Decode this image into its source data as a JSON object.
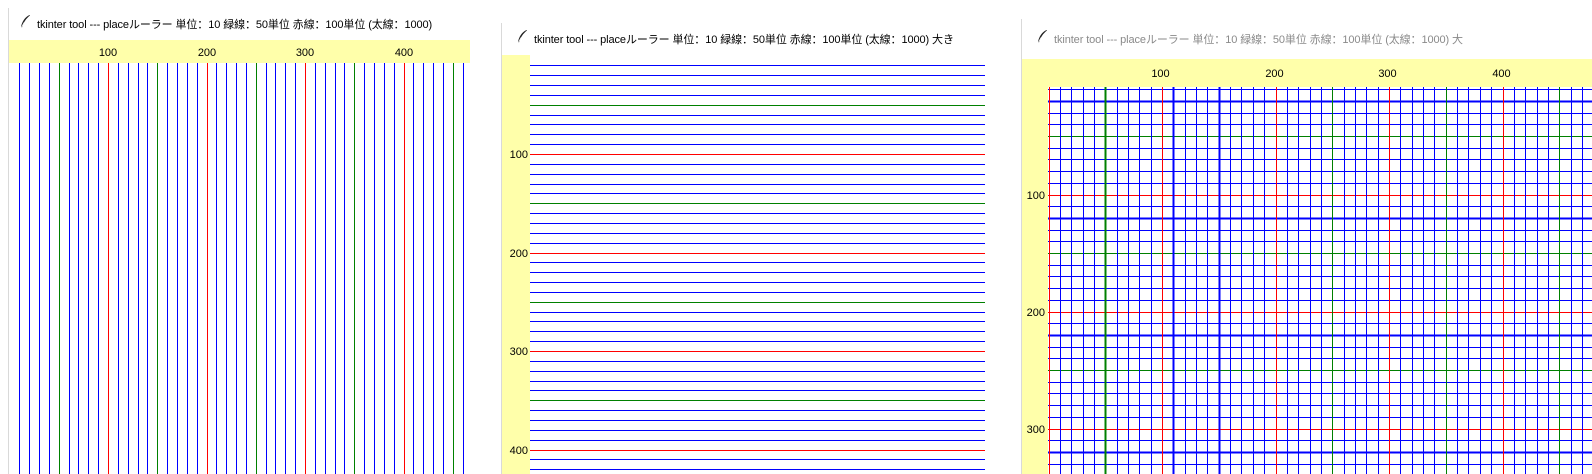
{
  "colors": {
    "ruler_background": "#ffffaa",
    "unit_line": "#0000ff",
    "green_line": "#008000",
    "red_line": "#ff0000",
    "thick_line": "#0000ff"
  },
  "windows": [
    {
      "icon": "feather-icon",
      "title": "tkinter tool  --- placeルーラー  単位：10  緑線：50単位  赤線：100単位 (太線：1000)",
      "mode": "vertical-lines",
      "ruler_labels": [
        "100",
        "200",
        "300",
        "400"
      ]
    },
    {
      "icon": "feather-icon",
      "title": "tkinter tool  --- placeルーラー  単位：10  緑線：50単位  赤線：100単位 (太線：1000)  大き",
      "mode": "horizontal-lines",
      "ruler_labels": [
        "100",
        "200",
        "300",
        "400"
      ]
    },
    {
      "icon": "feather-icon",
      "title": "tkinter tool  --- placeルーラー  単位：10  緑線：50単位  赤線：100単位 (太線：1000)  大",
      "mode": "grid",
      "top_ruler_labels": [
        "100",
        "200",
        "300",
        "400"
      ],
      "left_ruler_labels": [
        "100",
        "200",
        "300"
      ]
    }
  ]
}
